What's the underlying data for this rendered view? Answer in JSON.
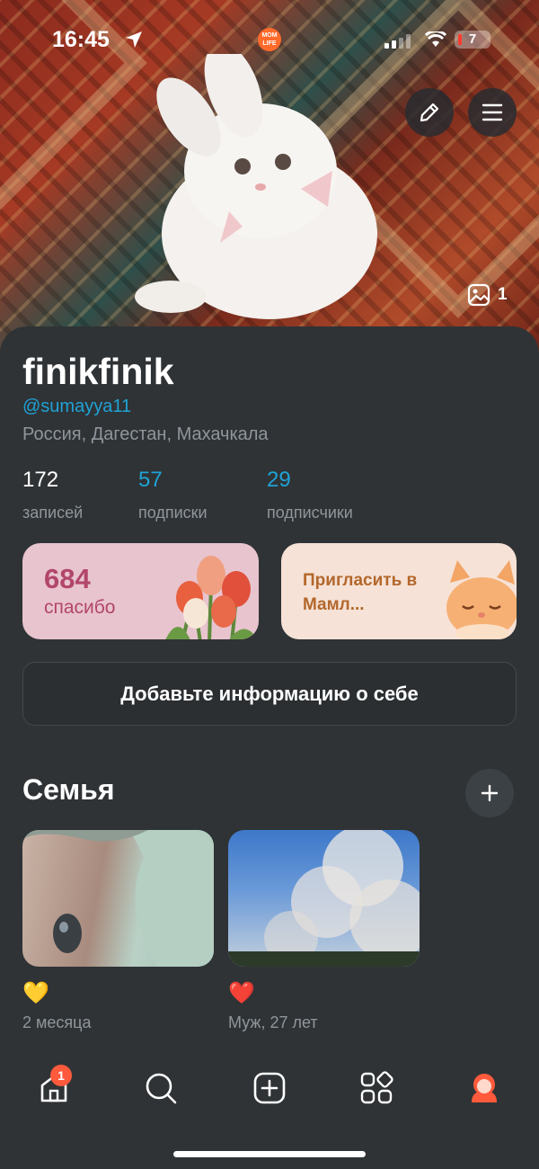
{
  "status_bar": {
    "time": "16:45",
    "app_badge": "MOM LIFE",
    "battery": "7"
  },
  "cover": {
    "photos_count": "1"
  },
  "profile": {
    "name": "finikfinik",
    "handle": "@sumayya11",
    "location": "Россия, Дагестан, Махачкала",
    "stats": [
      {
        "value": "172",
        "label": "записей"
      },
      {
        "value": "57",
        "label": "подписки"
      },
      {
        "value": "29",
        "label": "подписчики"
      }
    ]
  },
  "cards": {
    "thanks_count": "684",
    "thanks_label": "спасибо",
    "invite_label": "Пригласить в Мамл..."
  },
  "about_button": "Добавьте информацию о себе",
  "family": {
    "title": "Семья",
    "members": [
      {
        "emoji": "💛",
        "label": "2 месяца"
      },
      {
        "emoji": "❤️",
        "label": "Муж, 27 лет"
      }
    ]
  },
  "nav": {
    "home_badge": "1",
    "items": [
      "home-icon",
      "search-icon",
      "add-icon",
      "services-icon",
      "profile-icon"
    ]
  },
  "colors": {
    "background": "#2f3336",
    "accent_blue": "#1fa3d6",
    "thanks_pink": "#e8c4cf",
    "thanks_text": "#b2466a",
    "invite_peach": "#f6e2d6",
    "invite_text": "#b3672c",
    "badge_red": "#ff5a3c"
  }
}
